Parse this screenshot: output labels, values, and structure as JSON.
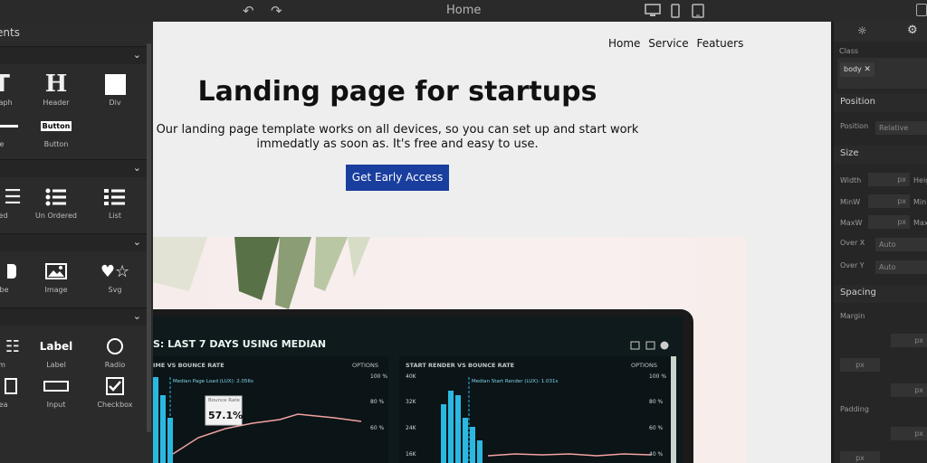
{
  "topbar": {
    "title": "Home",
    "undo_icon": "undo-icon",
    "redo_icon": "redo-icon",
    "devices": [
      "desktop-icon",
      "tablet-icon",
      "mobile-icon"
    ]
  },
  "left_panel": {
    "header": "ents",
    "blocks": [
      {
        "label": "graph",
        "icon": "paragraph-icon"
      },
      {
        "label": "Header",
        "icon": "header-icon"
      },
      {
        "label": "Div",
        "icon": "div-icon"
      },
      {
        "label": "e",
        "icon": "link-icon"
      },
      {
        "label": "Button",
        "icon": "button-icon",
        "icon_text": "Button"
      },
      {
        "label": "red",
        "icon": "ordered-list-icon"
      },
      {
        "label": "Un Ordered",
        "icon": "unordered-list-icon"
      },
      {
        "label": "List",
        "icon": "list-icon"
      },
      {
        "label": "ube",
        "icon": "youtube-icon"
      },
      {
        "label": "Image",
        "icon": "image-icon"
      },
      {
        "label": "Svg",
        "icon": "svg-icon"
      },
      {
        "label": "m",
        "icon": "form-icon"
      },
      {
        "label": "Label",
        "icon": "label-icon",
        "icon_text": "Label"
      },
      {
        "label": "Radio",
        "icon": "radio-icon"
      },
      {
        "label": "rea",
        "icon": "textarea-icon"
      },
      {
        "label": "Input",
        "icon": "input-icon"
      },
      {
        "label": "Checkbox",
        "icon": "checkbox-icon"
      }
    ]
  },
  "canvas": {
    "nav": [
      "Home",
      "Service",
      "Featuers"
    ],
    "title": "Landing page for startups",
    "text": "Our landing page template works on all devices, so you can set up and start work immedatly as soon as. It's free and easy to use.",
    "cta": "Get Early Access",
    "dashboard": {
      "heading": "S: LAST 7 DAYS USING MEDIAN",
      "left_title": "IME VS BOUNCE RATE",
      "right_title": "START RENDER VS BOUNCE RATE",
      "options": "OPTIONS",
      "left_note": "Median Page Load (LUX): 2.056s",
      "right_note": "Median Start Render (LUX): 1.031s",
      "tooltip_label": "Bounce Rate",
      "tooltip_value": "57.1%",
      "left_ticks": [
        "100 %",
        "80 %",
        "60 %"
      ],
      "right_left_ticks": [
        "40K",
        "32K",
        "24K",
        "16K"
      ],
      "right_ticks": [
        "100 %",
        "80 %",
        "60 %",
        "40 %"
      ]
    }
  },
  "right_panel": {
    "class_label": "Class",
    "class_tag": "body",
    "sections": {
      "position": "Position",
      "size": "Size",
      "spacing": "Spacing"
    },
    "position_label": "Position",
    "position_value": "Relative",
    "width_label": "Width",
    "height_label": "Heig",
    "minw_label": "MinW",
    "minh_label": "Mini",
    "maxw_label": "MaxW",
    "maxh_label": "Max",
    "overx_label": "Over X",
    "overy_label": "Over Y",
    "auto": "Auto",
    "px": "px",
    "margin_label": "Margin",
    "padding_label": "Padding"
  },
  "colors": {
    "accent": "#1a3e9e",
    "canvas_bg": "#eeeeee",
    "panel_bg": "#2b2b2b"
  }
}
